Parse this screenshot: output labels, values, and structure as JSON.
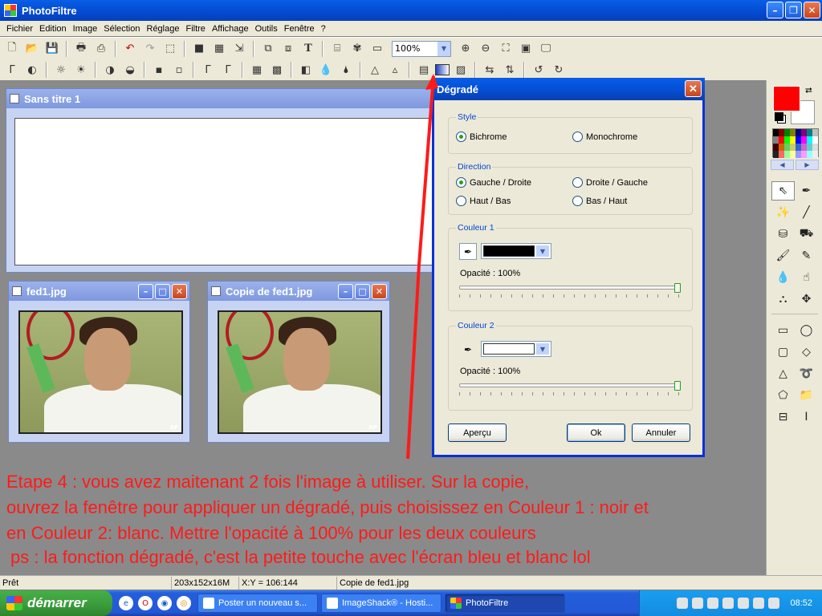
{
  "app": {
    "title": "PhotoFiltre"
  },
  "menu": [
    "Fichier",
    "Edition",
    "Image",
    "Sélection",
    "Réglage",
    "Filtre",
    "Affichage",
    "Outils",
    "Fenêtre",
    "?"
  ],
  "toolbar": {
    "zoom_value": "100%"
  },
  "windows": {
    "untitled": {
      "title": "Sans titre 1"
    },
    "fed1": {
      "title": "fed1.jpg",
      "photo_credit": "AP"
    },
    "copy": {
      "title": "Copie de fed1.jpg",
      "photo_credit": "AP"
    }
  },
  "dialog": {
    "title": "Dégradé",
    "style": {
      "label": "Style",
      "options": [
        "Bichrome",
        "Monochrome"
      ],
      "selected": "Bichrome"
    },
    "direction": {
      "label": "Direction",
      "options": [
        "Gauche / Droite",
        "Droite / Gauche",
        "Haut / Bas",
        "Bas / Haut"
      ],
      "selected": "Gauche / Droite"
    },
    "color1": {
      "label": "Couleur 1",
      "color": "#000000",
      "opacity_label": "Opacité : 100%",
      "opacity": 1.0
    },
    "color2": {
      "label": "Couleur 2",
      "color": "#ffffff",
      "opacity_label": "Opacité : 100%",
      "opacity": 1.0
    },
    "buttons": {
      "preview": "Aperçu",
      "ok": "Ok",
      "cancel": "Annuler"
    }
  },
  "colors": {
    "foreground": "#ff0000",
    "background": "#ffffff",
    "annotation": "#ff1a1a"
  },
  "annotation": {
    "line1": "Etape 4 : vous avez maitenant 2 fois l'image à utiliser. Sur la copie,",
    "line2": "ouvrez la fenêtre pour appliquer un dégradé, puis choisissez en Couleur 1 : noir et",
    "line3": "en Couleur 2: blanc. Mettre l'opacité à 100% pour les deux couleurs",
    "line4": "ps : la fonction dégradé, c'est la petite touche avec l'écran bleu et blanc lol"
  },
  "status": {
    "state": "Prêt",
    "image_info": "203x152x16M",
    "coords": "X:Y = 106:144",
    "file": "Copie de fed1.jpg"
  },
  "taskbar": {
    "start": "démarrer",
    "tasks": [
      "Poster un nouveau s...",
      "ImageShack® - Hosti...",
      "PhotoFiltre"
    ],
    "active_task": "PhotoFiltre",
    "clock": "08:52"
  }
}
